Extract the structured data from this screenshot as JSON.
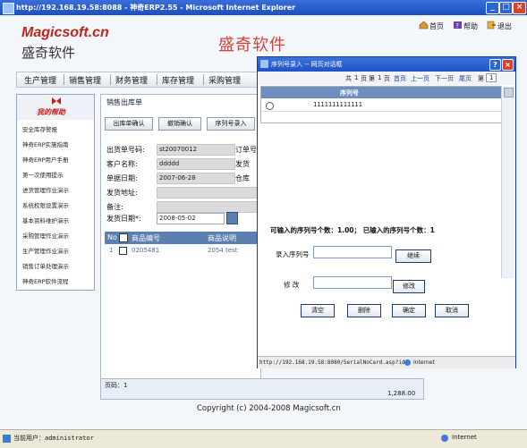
{
  "window": {
    "title": "http://192.168.19.58:8088 - 神奇ERP2.55 - Microsoft Internet Explorer",
    "min": "_",
    "max": "□",
    "close": "×"
  },
  "header": {
    "brand": "Magicsoft.cn",
    "brand_cn": "盛奇软件",
    "banner": "盛奇软件",
    "links": [
      "首页",
      "帮助",
      "退出"
    ]
  },
  "nav": [
    "生产管理",
    "销售管理",
    "财务管理",
    "库存管理",
    "采购管理"
  ],
  "sidebar": {
    "title": "我的帮助",
    "items": [
      "安全库存警报",
      "神奇ERP实施指南",
      "神奇ERP用户手册",
      "第一次使用提示",
      "进货管理作业演示",
      "系统权限设置演示",
      "基本资料维护演示",
      "采购管理作业演示",
      "生产管理作业演示",
      "销售订单处理演示",
      "神奇ERP软件流程"
    ]
  },
  "content": {
    "title": "销售出库单",
    "buttons": [
      "出库单确认",
      "撤销确认",
      "序列号录入"
    ],
    "fields": [
      {
        "label": "出货单号码:",
        "value": "st20070012"
      },
      {
        "label": "客户名称:",
        "value": "ddddd"
      },
      {
        "label": "单据日期:",
        "value": "2007-06-28"
      },
      {
        "label": "发货地址:",
        "value": ""
      },
      {
        "label": "备注:",
        "value": ""
      },
      {
        "label": "发货日期*:",
        "value": "2008-05-02"
      }
    ],
    "right_labels": [
      "订单号",
      "发货",
      "仓库"
    ],
    "grid_headers": [
      "No",
      "商品编号",
      "商品说明"
    ],
    "grid_row": {
      "no": "1",
      "code": "0205481",
      "desc": "2054 test"
    },
    "footer_page": "页码：1",
    "footer_total": "1,288.00"
  },
  "popup": {
    "title": "序列号录入 -- 网页对话框",
    "toolbar": {
      "total": "共",
      "total_count": "1",
      "unit": "页",
      "page_prefix": "第",
      "page_num": "1",
      "page_suffix": "页",
      "first": "首页",
      "prev": "上一页",
      "next": "下一页",
      "last": "尾页",
      "goto": "第",
      "goto_num": "1"
    },
    "table_header": "序列号",
    "table_row": "1111111111111",
    "count_text": "可输入的序列号个数：1.00； 已输入的序列号个数：1",
    "input_label": "录入序列号",
    "continue_btn": "继续",
    "modify_label": "修  改",
    "modify_btn": "修改",
    "bottom_buttons": [
      "清空",
      "删除",
      "确定",
      "取消"
    ],
    "status_url": "http://192.168.19.58:8080/SerialNoCard.asp?id=",
    "status_zone": "Internet"
  },
  "copyright": "Copyright (c) 2004-2008 Magicsoft.cn",
  "statusbar": {
    "user": "当前用户：administrator",
    "zone": "Internet"
  }
}
